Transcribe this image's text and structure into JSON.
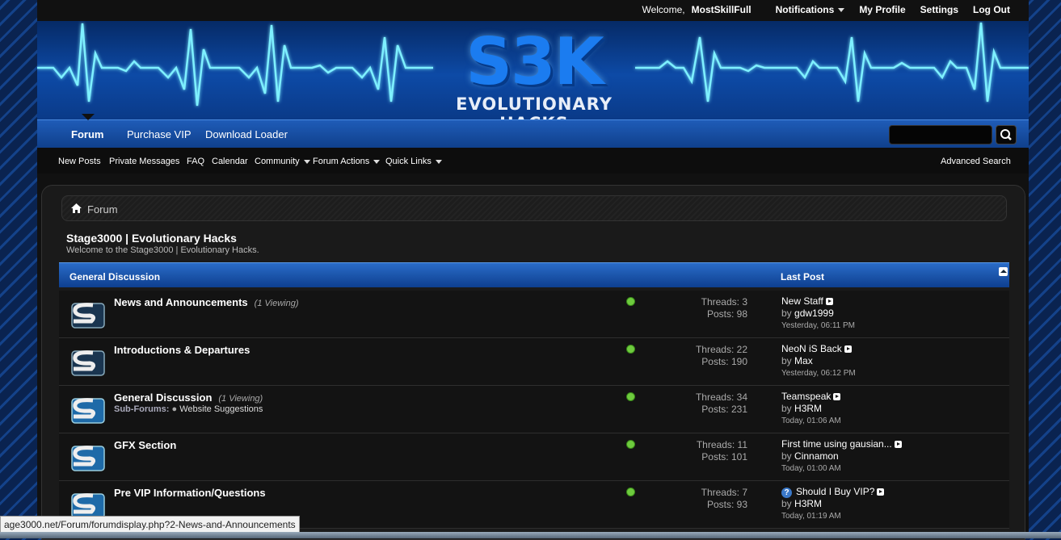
{
  "topbar": {
    "welcome": "Welcome,",
    "username": "MostSkillFull",
    "links": [
      "Notifications",
      "My Profile",
      "Settings",
      "Log Out"
    ]
  },
  "banner": {
    "logo_main": "S3K",
    "logo_sub": "EVOLUTIONARY HACKS"
  },
  "nav": {
    "tabs": [
      "Forum",
      "Purchase VIP",
      "Download Loader"
    ],
    "search_placeholder": ""
  },
  "subnav": {
    "items": [
      "New Posts",
      "Private Messages",
      "FAQ",
      "Calendar",
      "Community",
      "Forum Actions",
      "Quick Links"
    ],
    "advanced_search": "Advanced Search"
  },
  "breadcrumb": {
    "label": "Forum"
  },
  "site": {
    "title": "Stage3000 | Evolutionary Hacks",
    "description": "Welcome to the Stage3000 | Evolutionary Hacks."
  },
  "category": {
    "title": "General Discussion",
    "last_post_header": "Last Post"
  },
  "forums": [
    {
      "name": "News and Announcements",
      "viewing": "(1 Viewing)",
      "subforums_label": "",
      "subforum": "",
      "threads": "Threads: 3",
      "posts": "Posts: 98",
      "last_title": "New Staff",
      "last_by": "by",
      "last_user": "gdw1999",
      "last_time": "Yesterday, 06:11 PM"
    },
    {
      "name": "Introductions & Departures",
      "viewing": "",
      "subforums_label": "",
      "subforum": "",
      "threads": "Threads: 22",
      "posts": "Posts: 190",
      "last_title": "NeoN iS Back",
      "last_by": "by",
      "last_user": "Max",
      "last_time": "Yesterday, 06:12 PM"
    },
    {
      "name": "General Discussion",
      "viewing": "(1 Viewing)",
      "subforums_label": "Sub-Forums:",
      "subforum": "Website Suggestions",
      "threads": "Threads: 34",
      "posts": "Posts: 231",
      "last_title": "Teamspeak",
      "last_by": "by",
      "last_user": "H3RM",
      "last_time": "Today, 01:06 AM"
    },
    {
      "name": "GFX Section",
      "viewing": "",
      "subforums_label": "",
      "subforum": "",
      "threads": "Threads: 11",
      "posts": "Posts: 101",
      "last_title": "First time using gausian...",
      "last_by": "by",
      "last_user": "Cinnamon",
      "last_time": "Today, 01:00 AM"
    },
    {
      "name": "Pre VIP Information/Questions",
      "viewing": "",
      "subforums_label": "",
      "subforum": "",
      "threads": "Threads: 7",
      "posts": "Posts: 93",
      "last_title": "Should I Buy VIP?",
      "last_by": "by",
      "last_user": "H3RM",
      "last_time": "Today, 01:19 AM"
    }
  ],
  "statusbar": {
    "url": "age3000.net/Forum/forumdisplay.php?2-News-and-Announcements"
  },
  "colors": {
    "accent": "#1f5cb8",
    "online": "#6ecb3e"
  }
}
